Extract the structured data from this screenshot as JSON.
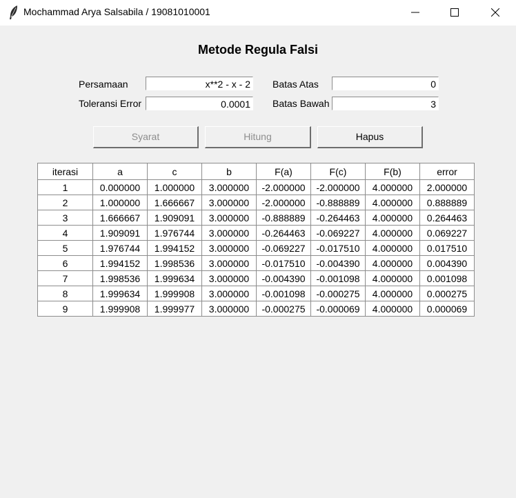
{
  "window": {
    "title": "Mochammad Arya Salsabila / 19081010001",
    "icon": "feather-icon"
  },
  "heading": "Metode Regula Falsi",
  "form": {
    "persamaan_label": "Persamaan",
    "persamaan_value": "x**2 - x - 2",
    "toleransi_label": "Toleransi Error",
    "toleransi_value": "0.0001",
    "batas_atas_label": "Batas Atas",
    "batas_atas_value": "0",
    "batas_bawah_label": "Batas Bawah",
    "batas_bawah_value": "3"
  },
  "buttons": {
    "syarat": "Syarat",
    "hitung": "Hitung",
    "hapus": "Hapus"
  },
  "table": {
    "headers": [
      "iterasi",
      "a",
      "c",
      "b",
      "F(a)",
      "F(c)",
      "F(b)",
      "error"
    ],
    "rows": [
      [
        "1",
        "0.000000",
        "1.000000",
        "3.000000",
        "-2.000000",
        "-2.000000",
        "4.000000",
        "2.000000"
      ],
      [
        "2",
        "1.000000",
        "1.666667",
        "3.000000",
        "-2.000000",
        "-0.888889",
        "4.000000",
        "0.888889"
      ],
      [
        "3",
        "1.666667",
        "1.909091",
        "3.000000",
        "-0.888889",
        "-0.264463",
        "4.000000",
        "0.264463"
      ],
      [
        "4",
        "1.909091",
        "1.976744",
        "3.000000",
        "-0.264463",
        "-0.069227",
        "4.000000",
        "0.069227"
      ],
      [
        "5",
        "1.976744",
        "1.994152",
        "3.000000",
        "-0.069227",
        "-0.017510",
        "4.000000",
        "0.017510"
      ],
      [
        "6",
        "1.994152",
        "1.998536",
        "3.000000",
        "-0.017510",
        "-0.004390",
        "4.000000",
        "0.004390"
      ],
      [
        "7",
        "1.998536",
        "1.999634",
        "3.000000",
        "-0.004390",
        "-0.001098",
        "4.000000",
        "0.001098"
      ],
      [
        "8",
        "1.999634",
        "1.999908",
        "3.000000",
        "-0.001098",
        "-0.000275",
        "4.000000",
        "0.000275"
      ],
      [
        "9",
        "1.999908",
        "1.999977",
        "3.000000",
        "-0.000275",
        "-0.000069",
        "4.000000",
        "0.000069"
      ]
    ]
  }
}
